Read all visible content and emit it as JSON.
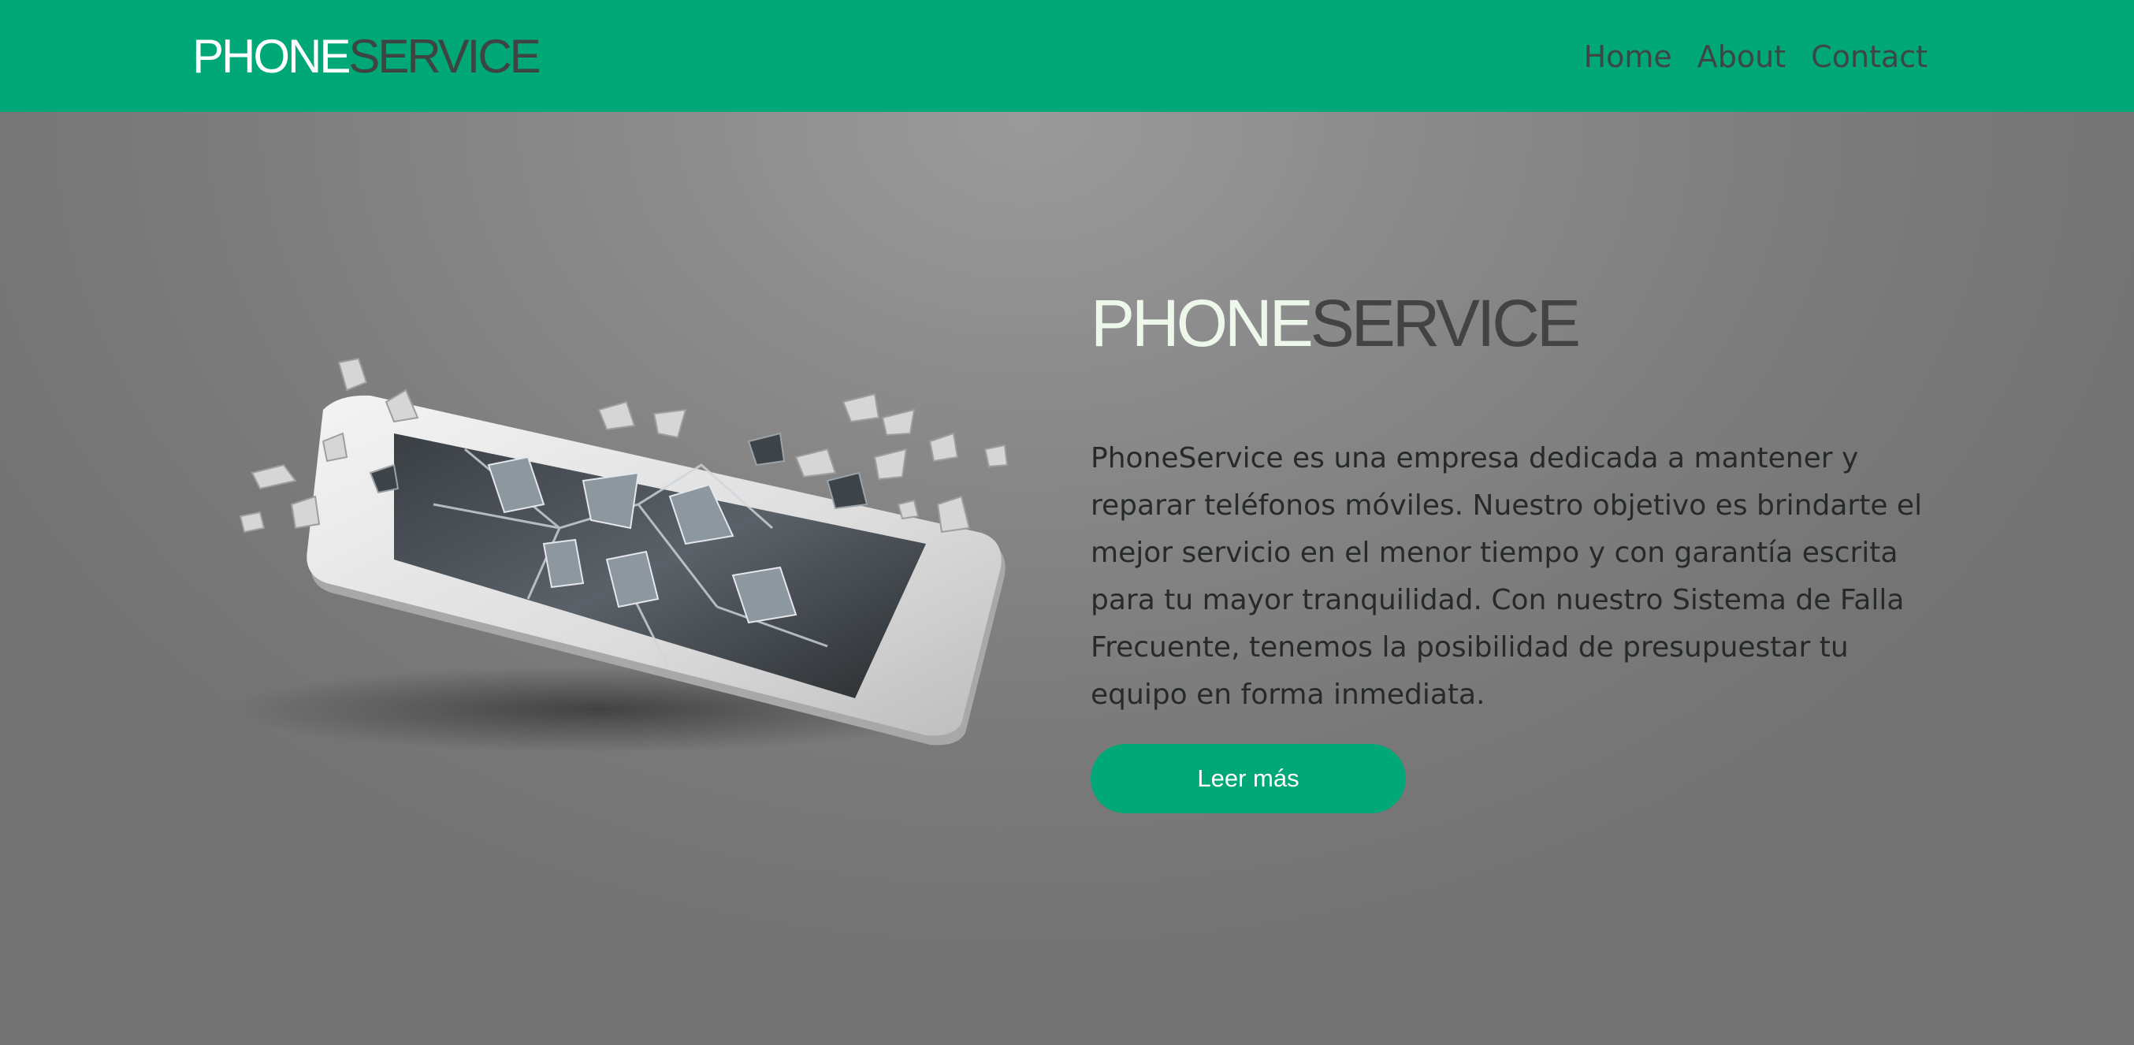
{
  "header": {
    "brand_part1": "PHONE",
    "brand_part2": "SERVICE",
    "nav": [
      "Home",
      "About",
      "Contact"
    ]
  },
  "hero": {
    "title_part1": "PHONE",
    "title_part2": "SERVICE",
    "description": "PhoneService es una empresa dedicada a mantener y reparar teléfonos móviles. Nuestro objetivo es brindarte el mejor servicio en el menor tiempo y con garantía escrita para tu mayor tranquilidad. Con nuestro Sistema de Falla Frecuente, tenemos la posibilidad de presupuestar tu equipo en forma inmediata.",
    "button_label": "Leer más",
    "image_icon": "broken-phone-illustration"
  },
  "colors": {
    "brand_green": "#00a878",
    "dark_gray": "#3d4543",
    "light_text": "#eef8ea"
  }
}
